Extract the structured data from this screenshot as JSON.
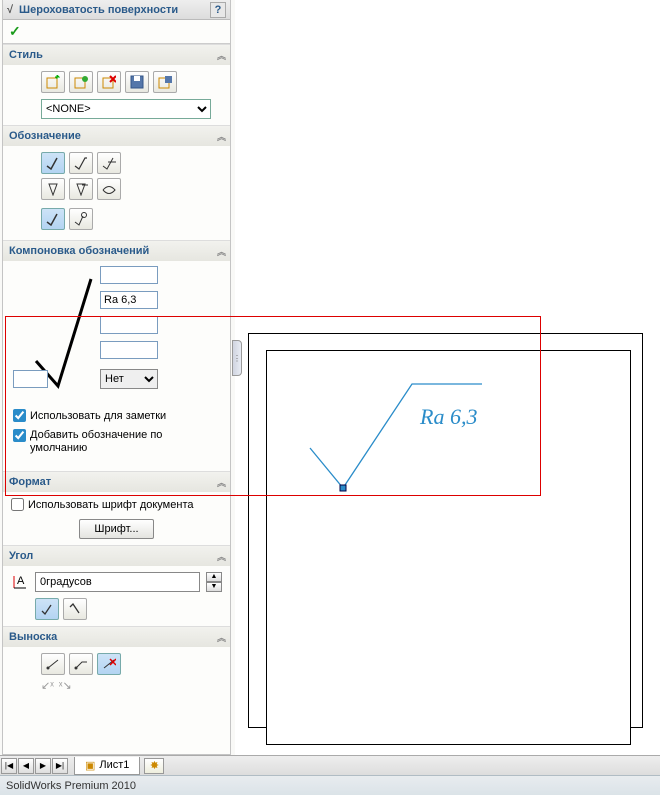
{
  "feature": {
    "title": "Шероховатость поверхности",
    "help": "?"
  },
  "style": {
    "header": "Стиль",
    "selected": "<NONE>"
  },
  "designation": {
    "header": "Обозначение"
  },
  "layout": {
    "header": "Компоновка обозначений",
    "input1": "",
    "input2": "Ra 6,3",
    "input3": "",
    "input4": "",
    "input5": "",
    "select_none": "Нет",
    "check1_label": "Использовать для заметки",
    "check2_label": "Добавить обозначение по умолчанию"
  },
  "format": {
    "header": "Формат",
    "check_label": "Использовать шрифт документа",
    "font_button": "Шрифт..."
  },
  "angle": {
    "header": "Угол",
    "value": "0градусов"
  },
  "leader": {
    "header": "Выноска"
  },
  "canvas": {
    "annotation_text": "Ra 6,3"
  },
  "sheet": {
    "tab_label": "Лист1"
  },
  "status": {
    "text": "SolidWorks Premium 2010"
  },
  "icons": {
    "check": "✓",
    "surface": "√"
  }
}
